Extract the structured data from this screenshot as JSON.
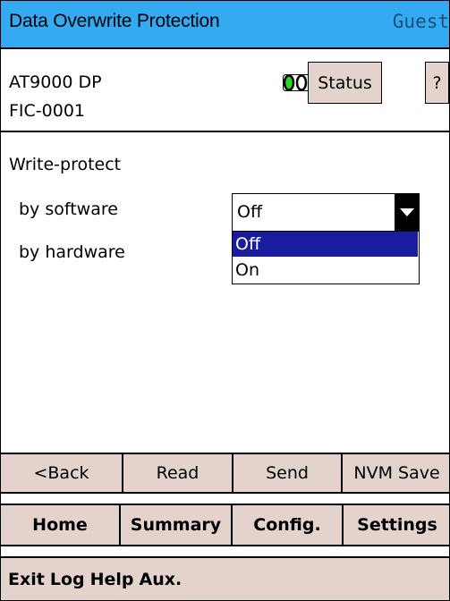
{
  "title_bar": {
    "title": "Data Overwrite Protection",
    "user": "Guest"
  },
  "device": {
    "model": "AT9000 DP",
    "tag": "FIC-0001"
  },
  "status_leds": [
    "green",
    "grey",
    "grey"
  ],
  "top_buttons": {
    "status": "Status",
    "help": "?"
  },
  "section": {
    "heading": "Write-protect"
  },
  "fields": {
    "software": {
      "label": "by software",
      "value": "Off"
    },
    "hardware": {
      "label": "by hardware"
    }
  },
  "dropdown": {
    "options": [
      "Off",
      "On"
    ],
    "selected": "Off"
  },
  "action_bar": [
    "<Back",
    "Read",
    "Send",
    "NVM Save"
  ],
  "nav_bar": [
    "Home",
    "Summary",
    "Config.",
    "Settings"
  ],
  "aux_bar": [
    "Exit",
    "Log",
    "Help",
    "Aux."
  ],
  "colors": {
    "title_bar": "#33aaf2",
    "button_bg": "#e3d3cc",
    "selection": "#1b1ba0",
    "led_on": "#22dd22"
  }
}
